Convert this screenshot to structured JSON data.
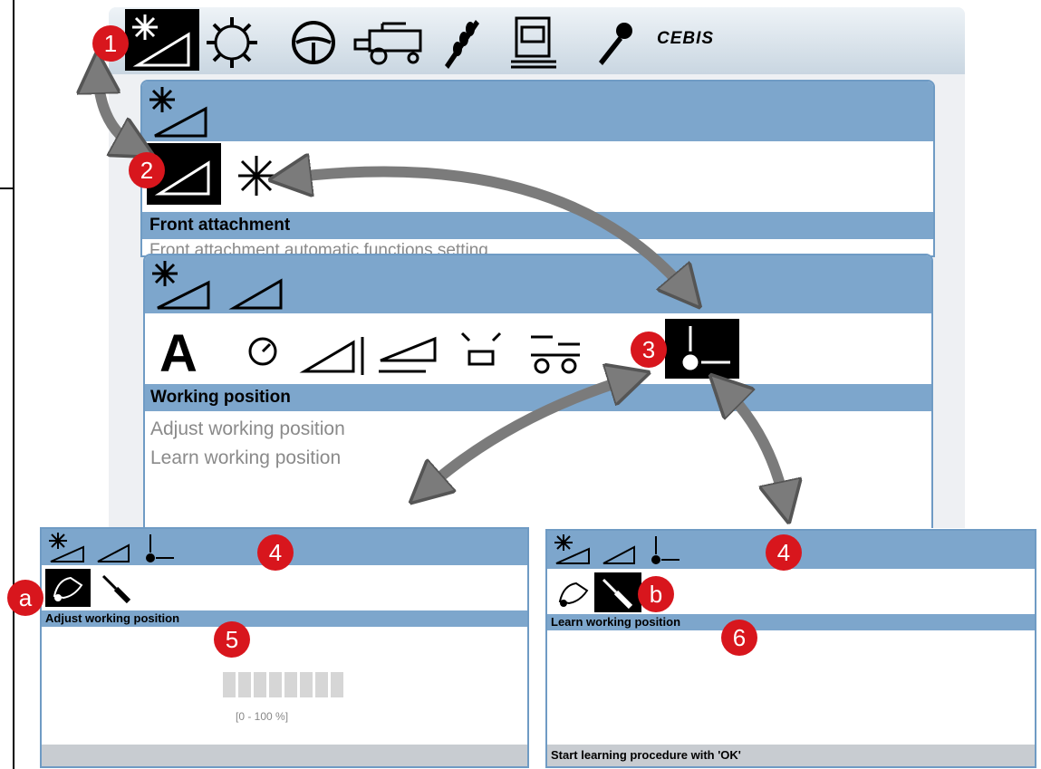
{
  "brand": "CEBIS",
  "topbar": {
    "icons": [
      "header-settings-icon",
      "threshing-drum-icon",
      "steering-wheel-icon",
      "combine-icon",
      "crop-icon",
      "counter-icon",
      "wrench-icon"
    ]
  },
  "panel1": {
    "section_title": "Front attachment",
    "sub_item": "Front attachment automatic functions setting"
  },
  "panel2": {
    "section_title": "Working position",
    "items": [
      "Adjust working position",
      "Learn working position"
    ]
  },
  "bottom_left": {
    "marker_top": "4",
    "marker_side": "a",
    "marker_body": "5",
    "section_title": "Adjust working position",
    "range": "[0 - 100 %]",
    "progress_segments": 8
  },
  "bottom_right": {
    "marker_top": "4",
    "marker_side": "b",
    "marker_body": "6",
    "section_title": "Learn working position",
    "status": "Start learning procedure with 'OK'"
  },
  "markers": [
    "1",
    "2",
    "3"
  ],
  "colors": {
    "panel_blue": "#7da6cc",
    "marker_red": "#d8161d",
    "arrow_grey": "#7b7b7b"
  }
}
